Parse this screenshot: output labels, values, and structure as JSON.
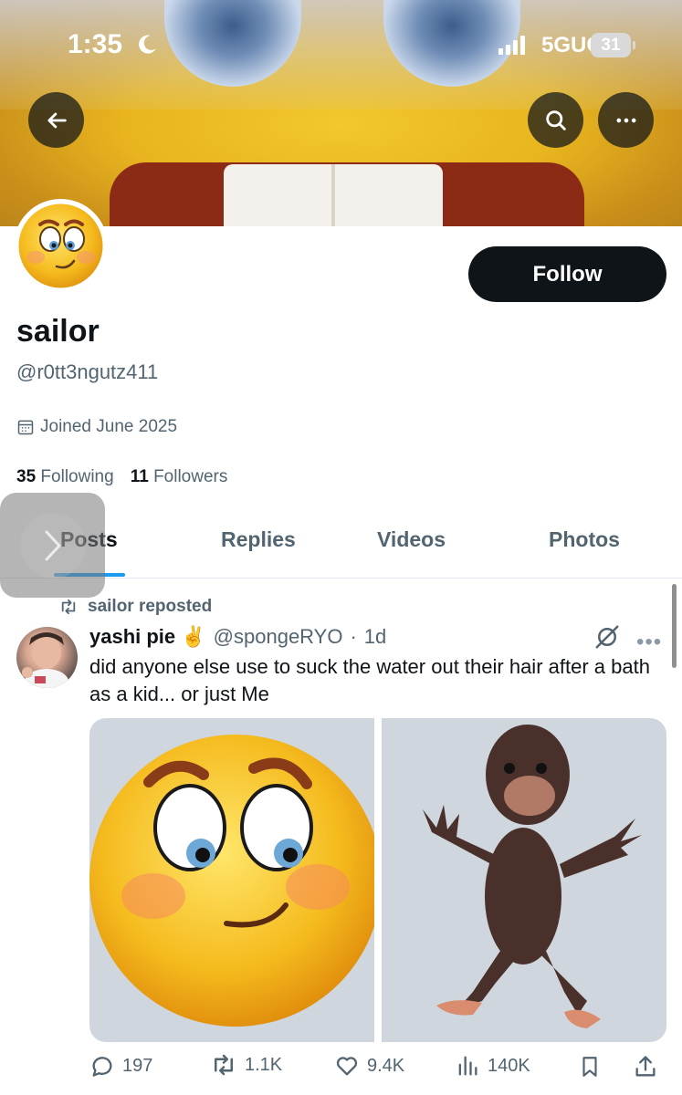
{
  "status_bar": {
    "time": "1:35",
    "network": "5GUC",
    "battery": "31"
  },
  "profile": {
    "display_name": "sailor",
    "handle": "@r0tt3ngutz411",
    "joined": "Joined June 2025",
    "following_count": "35",
    "following_label": "Following",
    "followers_count": "11",
    "followers_label": "Followers",
    "follow_label": "Follow"
  },
  "tabs": [
    {
      "label": "Posts",
      "active": true
    },
    {
      "label": "Replies",
      "active": false
    },
    {
      "label": "Videos",
      "active": false
    },
    {
      "label": "Photos",
      "active": false
    }
  ],
  "post": {
    "repost_label": "sailor reposted",
    "author_name": "yashi pie ✌️",
    "author_handle": "@spongeRYO",
    "time": "1d",
    "text": "did anyone else use to suck the water out their hair after a bath as a kid... or just Me",
    "replies": "197",
    "reposts": "1.1K",
    "likes": "9.4K",
    "views": "140K"
  },
  "colors": {
    "accent": "#1d9bf0",
    "text": "#0f1419",
    "muted": "#536471"
  }
}
